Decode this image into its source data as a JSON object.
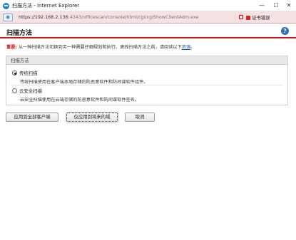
{
  "window": {
    "title": "扫描方法 - Internet Explorer",
    "minimize": "—",
    "maximize": "☐",
    "close": "✕"
  },
  "addressbar": {
    "url_main": "https://192.168.2.136",
    "url_rest": ":4343/officescan/console/html/cgi/cgiShowClientAdm.exe",
    "cert_error": "证书错误"
  },
  "header": {
    "title": "扫描方法",
    "help": "?"
  },
  "note": {
    "label": "重要:",
    "text": " 从一种扫描方法切换到另一种需要仔细规划和执行。更改扫描方法之前，请阅读以下",
    "link": "资源",
    "end": "。"
  },
  "panel": {
    "title": "扫描方法",
    "options": [
      {
        "label": "传统扫描",
        "desc": "传统扫描使用在客户端本地存储的防恶意软件和防间谍软件组件。",
        "checked": true
      },
      {
        "label": "云安全扫描",
        "desc": "云安全扫描使用在云端存储的防恶意软件和防间谍软件签名。",
        "checked": false
      }
    ]
  },
  "buttons": {
    "apply_all": "应用到全部客户端",
    "apply_future": "仅应用到将来的域",
    "cancel": "取消"
  },
  "colors": {
    "accent_red": "#c71a1a",
    "address_bg": "#f6e2e2",
    "link_blue": "#1a4fb8"
  }
}
